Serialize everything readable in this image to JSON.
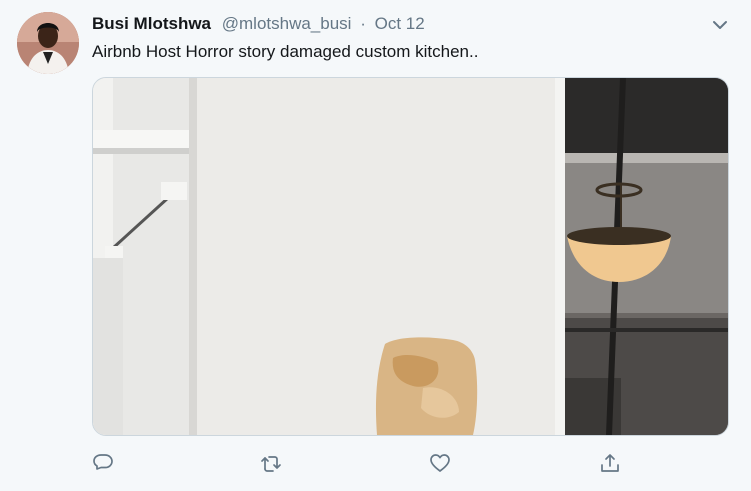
{
  "tweet": {
    "author_name": "Busi Mlotshwa",
    "handle": "@mlotshwa_busi",
    "separator": "·",
    "date": "Oct 12",
    "text": "Airbnb Host Horror story damaged custom kitchen.."
  },
  "icons": {
    "more": "chevron-down-icon",
    "reply": "reply-icon",
    "retweet": "retweet-icon",
    "like": "heart-icon",
    "share": "share-icon"
  },
  "colors": {
    "background": "#f5f8fa",
    "muted_text": "#657786",
    "icon": "#657786"
  }
}
